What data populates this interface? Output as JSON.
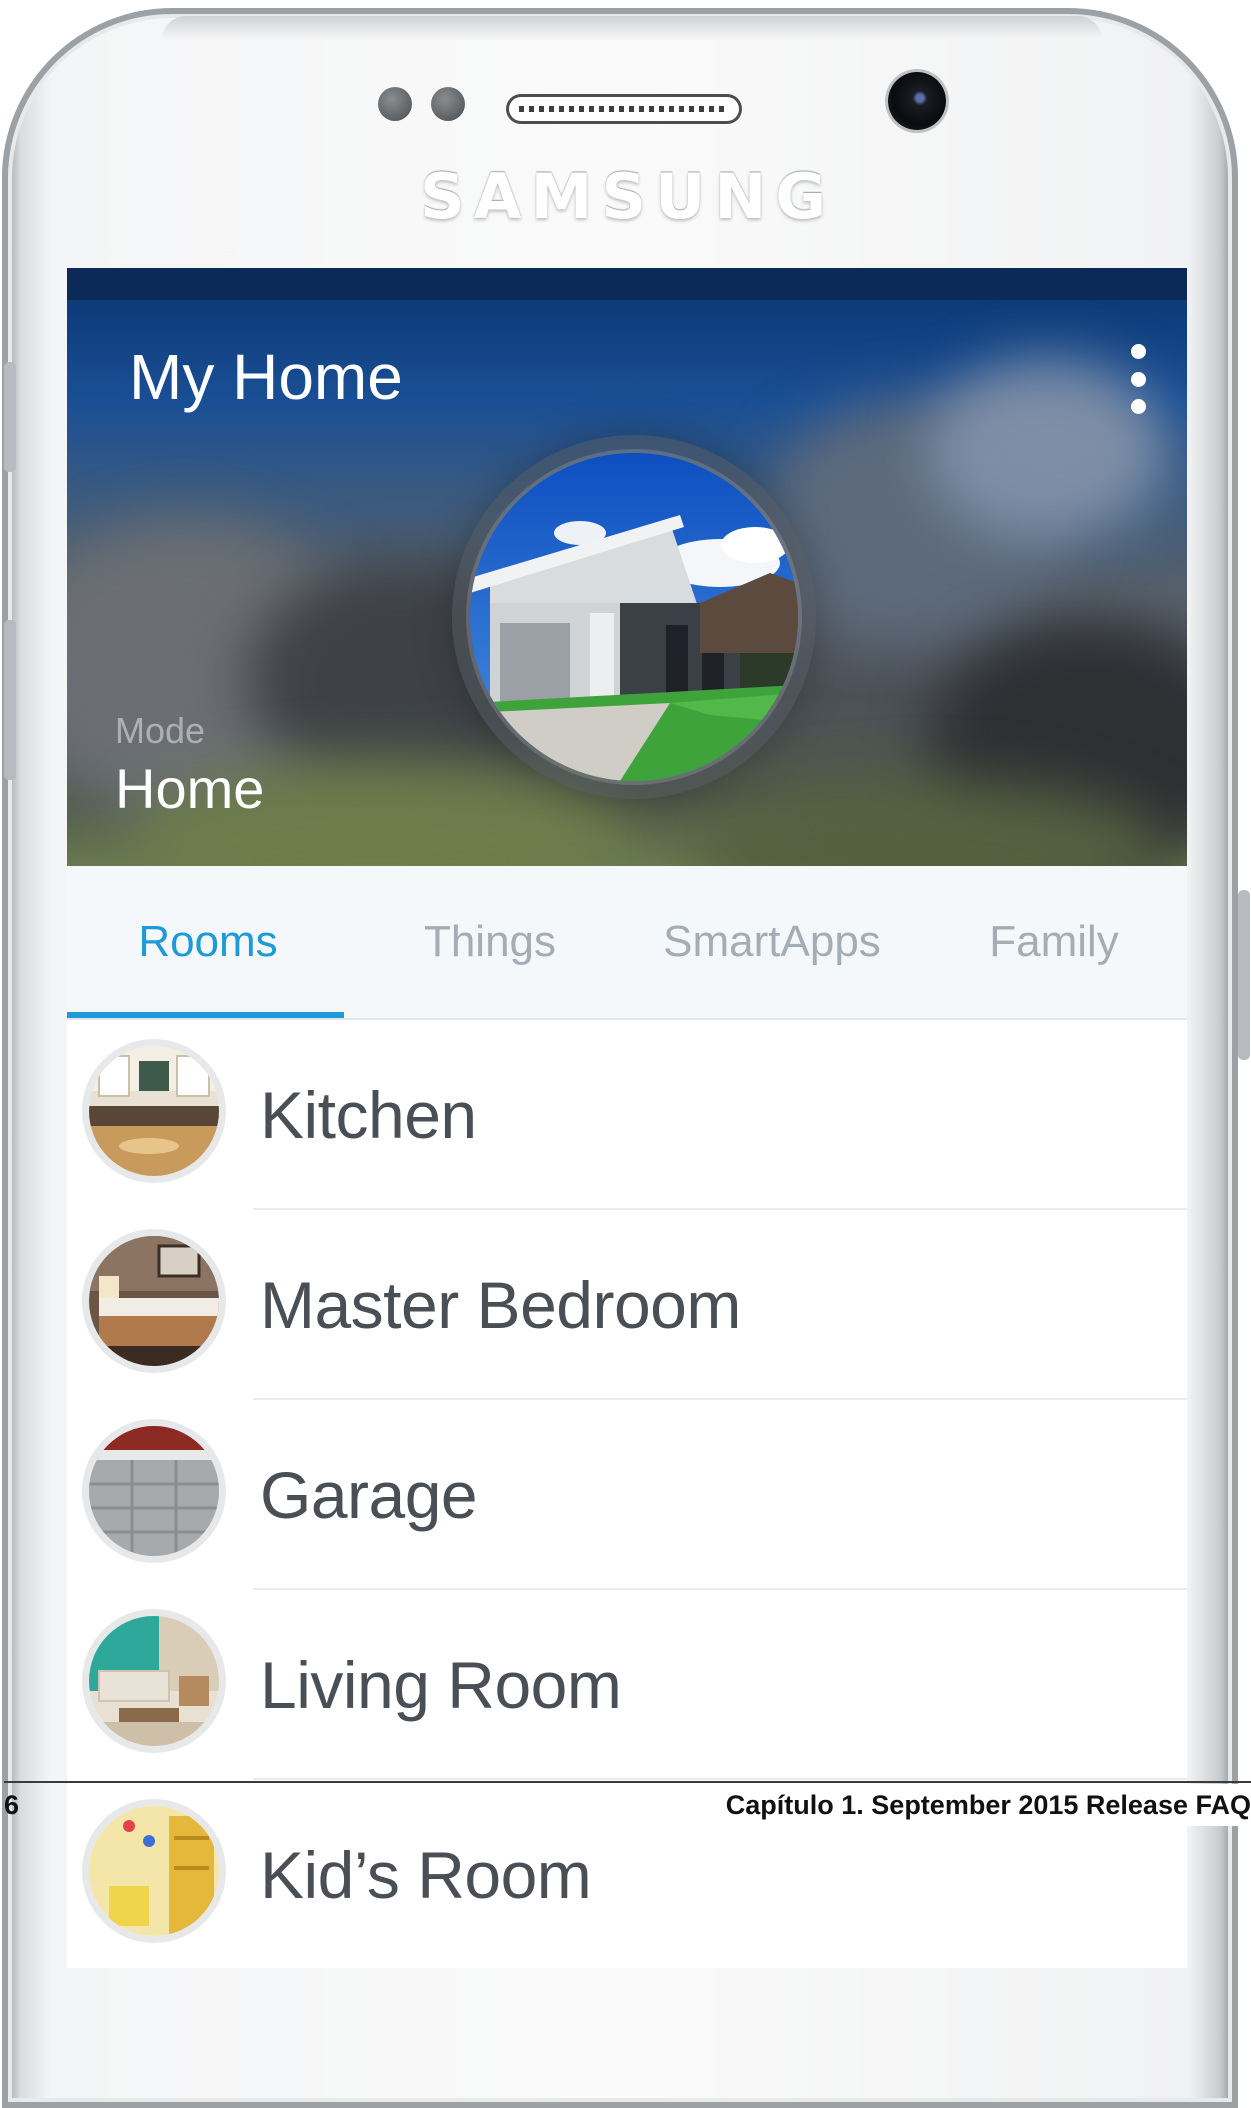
{
  "device": {
    "brand": "SAMSUNG"
  },
  "app": {
    "title": "My Home",
    "mode_label": "Mode",
    "mode_value": "Home",
    "menu_icon": "more-vertical-icon"
  },
  "tabs": [
    {
      "label": "Rooms",
      "active": true
    },
    {
      "label": "Things",
      "active": false
    },
    {
      "label": "SmartApps",
      "active": false
    },
    {
      "label": "Family",
      "active": false
    }
  ],
  "rooms": [
    {
      "name": "Kitchen"
    },
    {
      "name": "Master Bedroom"
    },
    {
      "name": "Garage"
    },
    {
      "name": "Living Room"
    },
    {
      "name": "Kid’s Room"
    }
  ],
  "page": {
    "number": "6",
    "chapter": "Capítulo 1.  September 2015 Release FAQ"
  },
  "colors": {
    "accent": "#1e9ad6",
    "header_dark": "#0c2a58",
    "tab_bg": "#f5f8fb"
  }
}
